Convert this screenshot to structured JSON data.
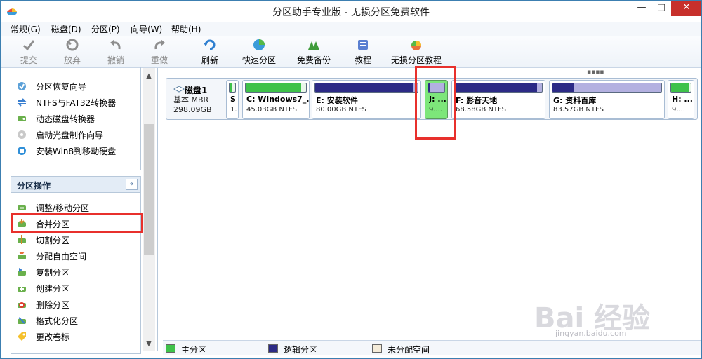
{
  "window": {
    "title": "分区助手专业版 - 无损分区免费软件",
    "min": "—",
    "max": "□",
    "close": "✕"
  },
  "menu": [
    "常规(G)",
    "磁盘(D)",
    "分区(P)",
    "向导(W)",
    "帮助(H)"
  ],
  "toolbar": [
    {
      "label": "提交",
      "icon": "check-icon",
      "enabled": false
    },
    {
      "label": "放弃",
      "icon": "discard-icon",
      "enabled": false
    },
    {
      "label": "撤销",
      "icon": "undo-icon",
      "enabled": false
    },
    {
      "label": "重做",
      "icon": "redo-icon",
      "enabled": false
    },
    {
      "label": "刷新",
      "icon": "refresh-icon",
      "enabled": true
    },
    {
      "label": "快速分区",
      "icon": "quick-partition-icon",
      "enabled": true
    },
    {
      "label": "免费备份",
      "icon": "backup-icon",
      "enabled": true
    },
    {
      "label": "教程",
      "icon": "tutorial-icon",
      "enabled": true
    },
    {
      "label": "无损分区教程",
      "icon": "lossless-tutorial-icon",
      "enabled": true
    }
  ],
  "wizard_list": [
    "分区恢复向导",
    "NTFS与FAT32转换器",
    "动态磁盘转换器",
    "启动光盘制作向导",
    "安装Win8到移动硬盘"
  ],
  "partition_ops": {
    "title": "分区操作",
    "collapse": "«",
    "items": [
      "调整/移动分区",
      "合并分区",
      "切割分区",
      "分配自由空间",
      "复制分区",
      "创建分区",
      "删除分区",
      "格式化分区",
      "更改卷标"
    ]
  },
  "disk": {
    "name": "磁盘1",
    "type": "基本 MBR",
    "size": "298.09GB",
    "partitions": [
      {
        "name": "S",
        "info": "1.",
        "kind": "primary",
        "used": 0.45
      },
      {
        "name": "C: Windows7_...",
        "info": "45.03GB NTFS",
        "kind": "primary",
        "used": 0.92
      },
      {
        "name": "E: 安装软件",
        "info": "80.00GB NTFS",
        "kind": "logical",
        "used": 0.95
      },
      {
        "name": "J: ...",
        "info": "9....",
        "kind": "logical",
        "used": 0.1,
        "selected": true
      },
      {
        "name": "F: 影音天地",
        "info": "68.58GB NTFS",
        "kind": "logical",
        "used": 0.94
      },
      {
        "name": "G: 资料百库",
        "info": "83.57GB NTFS",
        "kind": "logical",
        "used": 0.2
      },
      {
        "name": "H: ...",
        "info": "9....",
        "kind": "primary",
        "used": 0.9
      }
    ]
  },
  "legend": [
    "主分区",
    "逻辑分区",
    "未分配空间"
  ],
  "colors": {
    "primary": "#3fc24a",
    "logical": "#2c2a86",
    "unallocated": "#f5ecd9",
    "highlight": "#e8302c"
  },
  "watermark": {
    "text": "Bai 经验",
    "sub": "jingyan.baidu.com"
  }
}
